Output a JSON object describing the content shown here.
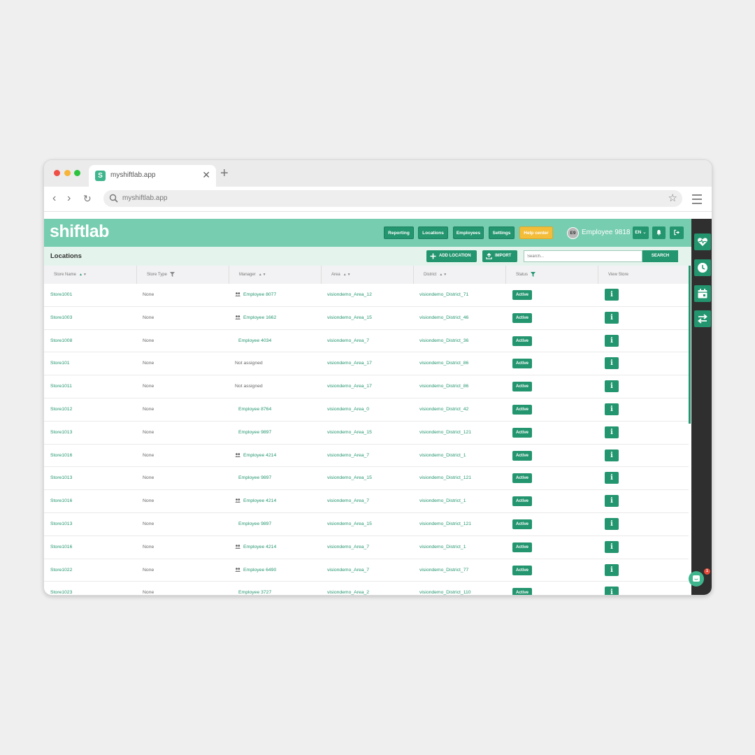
{
  "browser": {
    "tab_title": "myshiftlab.app",
    "url": "myshiftlab.app",
    "favicon_letter": "S"
  },
  "app": {
    "logo": "shiftlab",
    "nav": [
      "Reporting",
      "Locations",
      "Employees",
      "Settings",
      "Help center"
    ],
    "avatar_initials": "E9",
    "user_name": "Employee 9818",
    "language": "EN",
    "colors": {
      "primary": "#23956f",
      "header": "#76cdb0",
      "help": "#f3bd3a",
      "sidebar": "#2f2f2f"
    }
  },
  "toolbar": {
    "title": "Locations",
    "add_location": "ADD LOCATION",
    "import": "IMPORT",
    "search_placeholder": "Search...",
    "search_button": "SEARCH"
  },
  "table": {
    "headers": [
      "Store Name",
      "Store Type",
      "Manager",
      "Area",
      "District",
      "Status",
      "View Store"
    ],
    "rows": [
      {
        "store": "Store1001",
        "type": "None",
        "manager": "Employee 8077",
        "group": true,
        "area": "visiondemo_Area_12",
        "district": "visiondemo_District_71",
        "status": "Active"
      },
      {
        "store": "Store1003",
        "type": "None",
        "manager": "Employee 1662",
        "group": true,
        "area": "visiondemo_Area_15",
        "district": "visiondemo_District_46",
        "status": "Active"
      },
      {
        "store": "Store1008",
        "type": "None",
        "manager": "Employee 4034",
        "group": false,
        "area": "visiondemo_Area_7",
        "district": "visiondemo_District_36",
        "status": "Active"
      },
      {
        "store": "Store101",
        "type": "None",
        "manager": "Not assigned",
        "group": false,
        "area": "visiondemo_Area_17",
        "district": "visiondemo_District_86",
        "status": "Active"
      },
      {
        "store": "Store1011",
        "type": "None",
        "manager": "Not assigned",
        "group": false,
        "area": "visiondemo_Area_17",
        "district": "visiondemo_District_86",
        "status": "Active"
      },
      {
        "store": "Store1012",
        "type": "None",
        "manager": "Employee 8764",
        "group": false,
        "area": "visiondemo_Area_0",
        "district": "visiondemo_District_42",
        "status": "Active"
      },
      {
        "store": "Store1013",
        "type": "None",
        "manager": "Employee 9897",
        "group": false,
        "area": "visiondemo_Area_15",
        "district": "visiondemo_District_121",
        "status": "Active"
      },
      {
        "store": "Store1016",
        "type": "None",
        "manager": "Employee 4214",
        "group": true,
        "area": "visiondemo_Area_7",
        "district": "visiondemo_District_1",
        "status": "Active"
      },
      {
        "store": "Store1013",
        "type": "None",
        "manager": "Employee 9897",
        "group": false,
        "area": "visiondemo_Area_15",
        "district": "visiondemo_District_121",
        "status": "Active"
      },
      {
        "store": "Store1016",
        "type": "None",
        "manager": "Employee 4214",
        "group": true,
        "area": "visiondemo_Area_7",
        "district": "visiondemo_District_1",
        "status": "Active"
      },
      {
        "store": "Store1013",
        "type": "None",
        "manager": "Employee 9897",
        "group": false,
        "area": "visiondemo_Area_15",
        "district": "visiondemo_District_121",
        "status": "Active"
      },
      {
        "store": "Store1016",
        "type": "None",
        "manager": "Employee 4214",
        "group": true,
        "area": "visiondemo_Area_7",
        "district": "visiondemo_District_1",
        "status": "Active"
      },
      {
        "store": "Store1022",
        "type": "None",
        "manager": "Employee 6490",
        "group": true,
        "area": "visiondemo_Area_7",
        "district": "visiondemo_District_77",
        "status": "Active"
      },
      {
        "store": "Store1023",
        "type": "None",
        "manager": "Employee 3727",
        "group": false,
        "area": "visiondemo_Area_2",
        "district": "visiondemo_District_110",
        "status": "Active"
      }
    ]
  },
  "chat_badge": "1",
  "sidebar_icons": [
    "heart-pulse-icon",
    "clock-icon",
    "calendar-icon",
    "swap-arrows-icon"
  ]
}
